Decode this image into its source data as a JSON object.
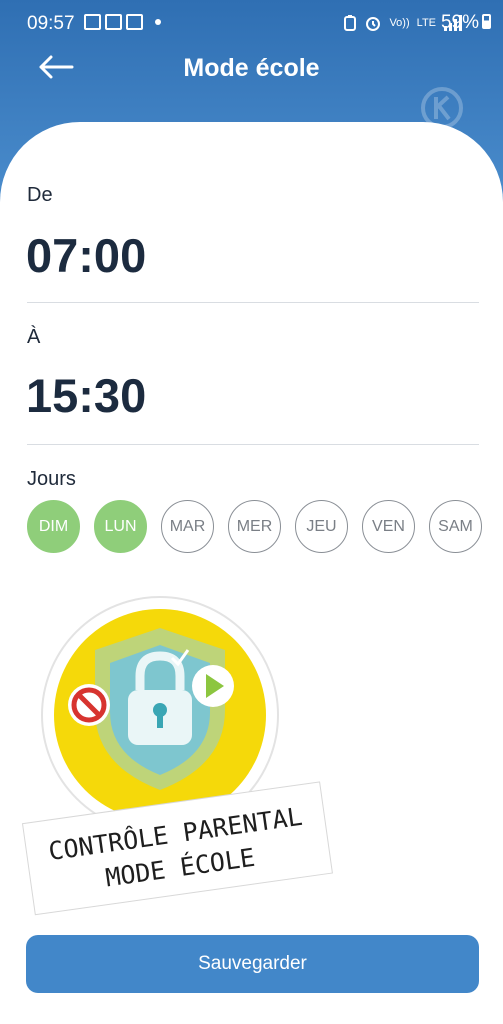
{
  "status_bar": {
    "time": "09:57",
    "battery": "59%",
    "network_labels": [
      "Vo))",
      "LTE",
      "LTE"
    ]
  },
  "header": {
    "title": "Mode école"
  },
  "schedule": {
    "from_label": "De",
    "from_time": "07:00",
    "to_label": "À",
    "to_time": "15:30",
    "days_label": "Jours",
    "days": [
      {
        "label": "DIM",
        "active": true
      },
      {
        "label": "LUN",
        "active": true
      },
      {
        "label": "MAR",
        "active": false
      },
      {
        "label": "MER",
        "active": false
      },
      {
        "label": "JEU",
        "active": false
      },
      {
        "label": "VEN",
        "active": false
      },
      {
        "label": "SAM",
        "active": false
      }
    ]
  },
  "promo": {
    "line1": "CONTRÔLE PARENTAL",
    "line2": "MODE ÉCOLE"
  },
  "save_label": "Sauvegarder",
  "colors": {
    "header_blue": "#3f7fc0",
    "active_day": "#8fce7a",
    "button_blue": "#4287c9",
    "promo_yellow": "#f5d90a"
  }
}
